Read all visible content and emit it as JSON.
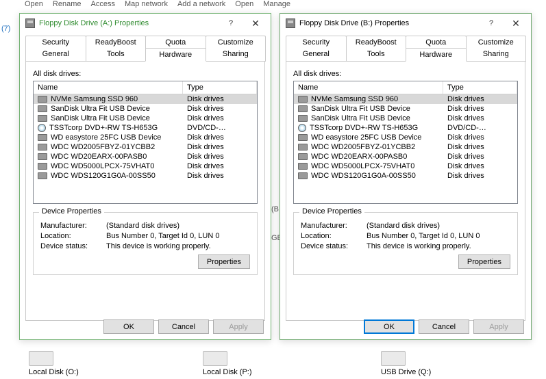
{
  "toolbar": [
    "Open",
    "Rename",
    "Access",
    "Map network",
    "Add a network",
    "Open",
    "Manage"
  ],
  "bg_left": [
    "(7)"
  ],
  "bg_mid": [
    "(B:)",
    "GB"
  ],
  "bg_drives": [
    {
      "label": "Local Disk (O:)"
    },
    {
      "label": "Local Disk (P:)"
    },
    {
      "label": "USB Drive (Q:)"
    }
  ],
  "tabs_row1": [
    "Security",
    "ReadyBoost",
    "Quota",
    "Customize"
  ],
  "tabs_row2": [
    "General",
    "Tools",
    "Hardware",
    "Sharing"
  ],
  "active_tab": "Hardware",
  "list_header": {
    "name": "Name",
    "type": "Type"
  },
  "section_label": "All disk drives:",
  "groupbox_title": "Device Properties",
  "prop_labels": {
    "manufacturer": "Manufacturer:",
    "location": "Location:",
    "status": "Device status:"
  },
  "prop_values": {
    "manufacturer": "(Standard disk drives)",
    "location": "Bus Number 0, Target Id 0, LUN 0",
    "status": "This device is working properly."
  },
  "buttons": {
    "properties": "Properties",
    "ok": "OK",
    "cancel": "Cancel",
    "apply": "Apply"
  },
  "drives": [
    {
      "name": "NVMe Samsung SSD 960",
      "type": "Disk drives",
      "icon": "hdd",
      "selected": true
    },
    {
      "name": "SanDisk Ultra Fit USB Device",
      "type": "Disk drives",
      "icon": "hdd"
    },
    {
      "name": "SanDisk Ultra Fit USB Device",
      "type": "Disk drives",
      "icon": "hdd"
    },
    {
      "name": "TSSTcorp DVD+-RW TS-H653G",
      "type": "DVD/CD-…",
      "icon": "cd"
    },
    {
      "name": "WD easystore 25FC USB Device",
      "type": "Disk drives",
      "icon": "hdd"
    },
    {
      "name": "WDC WD2005FBYZ-01YCBB2",
      "type": "Disk drives",
      "icon": "hdd"
    },
    {
      "name": "WDC WD20EARX-00PASB0",
      "type": "Disk drives",
      "icon": "hdd"
    },
    {
      "name": "WDC WD5000LPCX-75VHAT0",
      "type": "Disk drives",
      "icon": "hdd"
    },
    {
      "name": "WDC WDS120G1G0A-00SS50",
      "type": "Disk drives",
      "icon": "hdd"
    }
  ],
  "dialogs": [
    {
      "id": "a",
      "title": "Floppy Disk Drive (A:) Properties",
      "default_ok": false
    },
    {
      "id": "b",
      "title": "Floppy Disk Drive (B:) Properties",
      "default_ok": true
    }
  ]
}
